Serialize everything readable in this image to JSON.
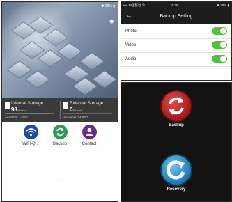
{
  "left": {
    "status_right": "✱ 29% ▮",
    "internal": {
      "title": "Internal Storage",
      "value": "93",
      "unit": "%Used",
      "available": "Available: 1.20G",
      "used_fraction": 0.93
    },
    "external": {
      "title": "External Storage",
      "value": "0",
      "unit": "%Used",
      "available": "Available: 14.92G",
      "used_fraction": 0.0
    },
    "apps": [
      {
        "label": "WiFi-Q...",
        "color": "#1f4aa8",
        "icon": "wifi-icon"
      },
      {
        "label": "Backup",
        "color": "#2e9a5a",
        "icon": "sync-icon"
      },
      {
        "label": "Contact",
        "color": "#6a2c8a",
        "icon": "person-icon"
      }
    ],
    "page_dots": "• •"
  },
  "right_top": {
    "status_left": "•••• 中国移动 令",
    "status_time": "15:28",
    "status_right": "✱ 29% ▮",
    "title": "Backup Setting",
    "rows": [
      {
        "label": "Photo",
        "on": true
      },
      {
        "label": "Video",
        "on": true
      },
      {
        "label": "Audio",
        "on": true
      }
    ],
    "toggle_color": "#55c040"
  },
  "right_bottom": {
    "backup_label": "Backup",
    "recovery_label": "Recovery",
    "backup_color": "#c42525",
    "recovery_color": "#2a8fd0"
  }
}
